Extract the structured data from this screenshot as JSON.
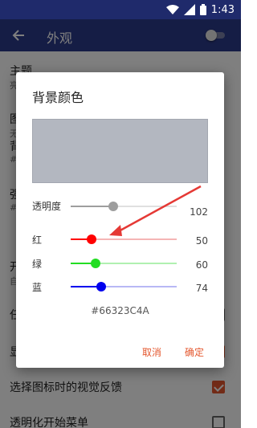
{
  "status_bar": {
    "time": "1:43",
    "icons": [
      "wifi-icon",
      "signal-icon",
      "battery-icon"
    ]
  },
  "app_bar": {
    "title": "外观",
    "back_icon": "arrow-back-icon",
    "switch_on": false
  },
  "settings": [
    {
      "title": "主题",
      "subtitle": "亮"
    },
    {
      "title": "图",
      "subtitle": "无"
    },
    {
      "title": "背",
      "subtitle": "#"
    },
    {
      "title": "强",
      "subtitle": "#"
    },
    {
      "title": "开",
      "subtitle": "自"
    },
    {
      "title": "任",
      "checked": false
    },
    {
      "title": "显",
      "checked": true
    },
    {
      "title": "选择图标时的视觉反馈",
      "checked": true
    },
    {
      "title": "透明化开始菜单",
      "checked": false
    }
  ],
  "dialog": {
    "title": "背景颜色",
    "preview_color": "#b3b7c0",
    "rows": [
      {
        "label": "透明度",
        "value": "102",
        "fraction": 0.4,
        "color": "#9e9e9e",
        "light": "#e0e0e0"
      },
      {
        "label": "红",
        "value": "50",
        "fraction": 0.196,
        "color": "#ff0000",
        "light": "#f5b5b5"
      },
      {
        "label": "绿",
        "value": "60",
        "fraction": 0.235,
        "color": "#22dd22",
        "light": "#b0f0b0"
      },
      {
        "label": "蓝",
        "value": "74",
        "fraction": 0.29,
        "color": "#0000ee",
        "light": "#b8b8f5"
      }
    ],
    "hex": "#66323C4A",
    "cancel": "取消",
    "ok": "确定"
  },
  "accent_color": "#e4572e",
  "annotation_arrow_color": "#e53935"
}
